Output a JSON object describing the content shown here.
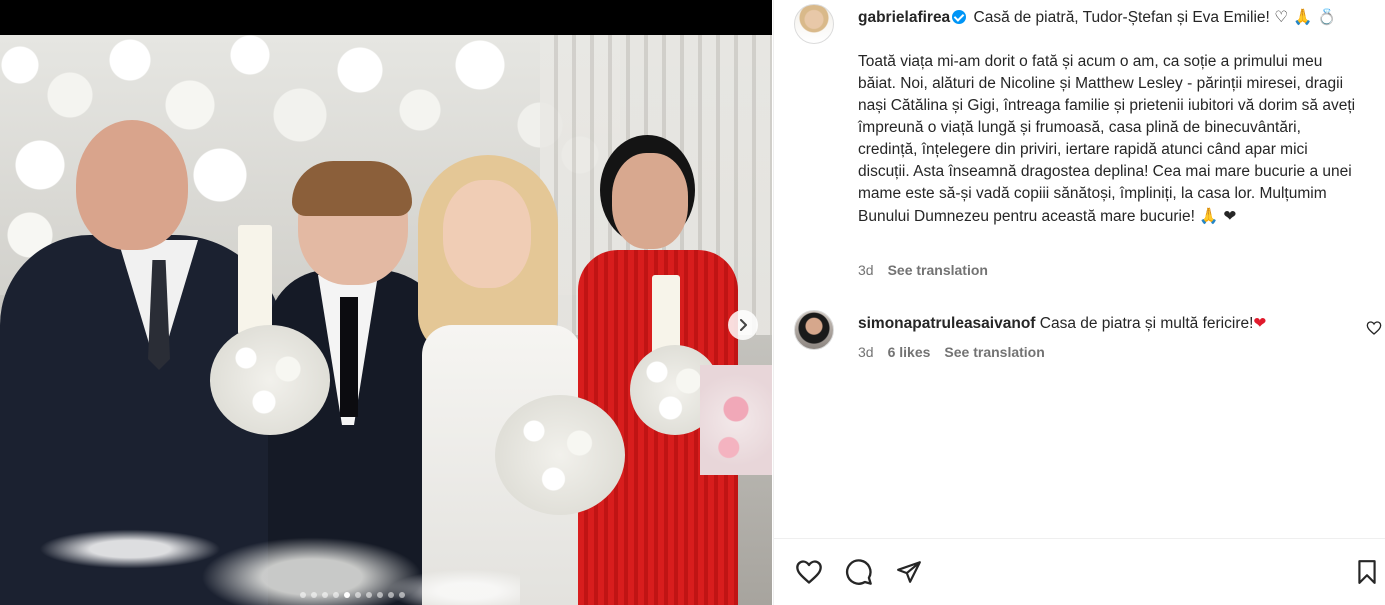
{
  "post": {
    "author": "gabrielafirea",
    "caption_title": "Casă de piatră, Tudor-Ștefan și Eva Emilie!",
    "caption_emojis": "♡ 🙏 💍",
    "caption_body": "Toată viața mi-am dorit o fată și acum o am, ca soție a primului meu băiat. Noi, alături de Nicoline și Matthew Lesley - părinții miresei, dragii nași Cătălina și Gigi, întreaga familie și prietenii iubitori vă dorim să aveți împreună o viață lungă și frumoasă, casa plină de binecuvântări, credință, înțelegere din priviri, iertare rapidă atunci când apar mici discuții. Asta înseamnă dragostea deplina! Cea mai mare bucurie a unei mame este să-și vadă copiii sănătoși, împliniți, la casa lor. Mulțumim Bunului Dumnezeu pentru această mare bucurie!",
    "caption_end_emojis": "🙏 ❤",
    "time": "3d",
    "see_translation": "See translation"
  },
  "comments": [
    {
      "author": "simonapatruleasaivanof",
      "text": "Casa de piatra și multă fericire!",
      "emoji": "❤",
      "time": "3d",
      "likes": "6 likes",
      "see_translation": "See translation"
    }
  ],
  "carousel": {
    "total_slides": 10,
    "active_slide": 5
  },
  "colors": {
    "verified": "#0095f6",
    "meta_text": "#737373",
    "heart_red": "#e0192b"
  },
  "icons": {
    "like": "heart-outline-icon",
    "comment": "comment-bubble-icon",
    "share": "paper-plane-icon",
    "save": "bookmark-icon",
    "next": "chevron-right-icon"
  }
}
